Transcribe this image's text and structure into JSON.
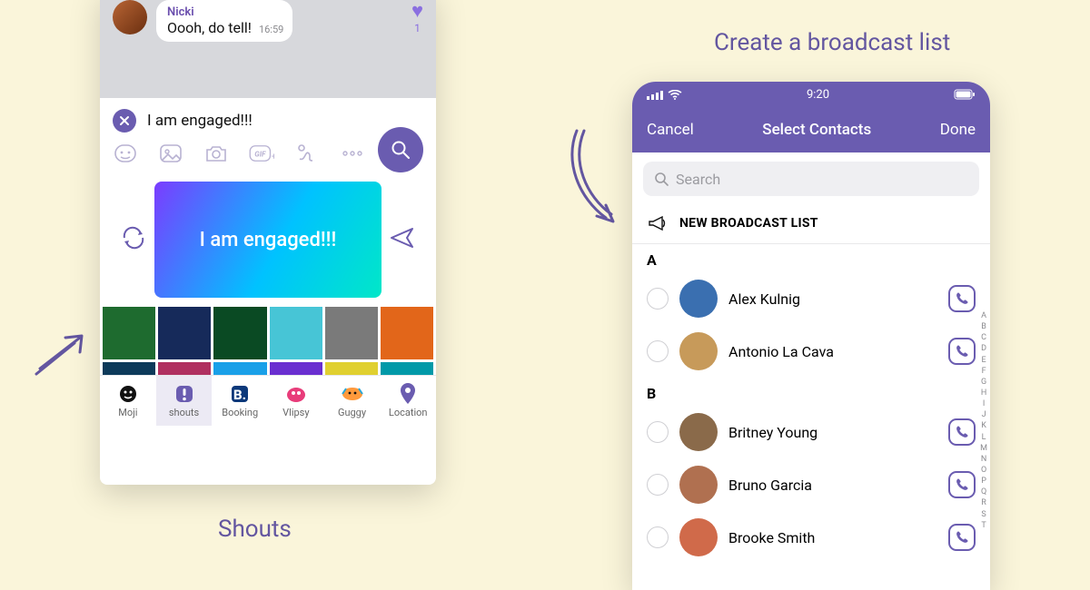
{
  "captions": {
    "left": "Shouts",
    "right": "Create a broadcast list"
  },
  "chat": {
    "sender": "Nicki",
    "message": "Oooh, do tell!",
    "time": "16:59",
    "reaction_count": "1"
  },
  "composer": {
    "text": "I am engaged!!!",
    "card_text": "I am engaged!!!"
  },
  "tool_icons": [
    "sticker-icon",
    "picture-icon",
    "camera-icon",
    "gif-icon",
    "doodle-icon",
    "more-icon"
  ],
  "bg_palettes_row1": [
    "#1e6b2f",
    "#162a5a",
    "#0a4a23",
    "#47c5d6",
    "#7a7a7a",
    "#e2661a"
  ],
  "bg_palettes_row2": [
    "#0d3a5a",
    "#b03060",
    "#1aa0e8",
    "#6a2fd0",
    "#e0d030",
    "#0099a8"
  ],
  "app_tabs": [
    {
      "id": "moji",
      "label": "Moji"
    },
    {
      "id": "shouts",
      "label": "shouts"
    },
    {
      "id": "booking",
      "label": "Booking"
    },
    {
      "id": "vlipsy",
      "label": "Vlipsy"
    },
    {
      "id": "guggy",
      "label": "Guggy"
    },
    {
      "id": "location",
      "label": "Location"
    }
  ],
  "app_tab_active": "shouts",
  "phone2": {
    "status_time": "9:20",
    "nav": {
      "left": "Cancel",
      "title": "Select Contacts",
      "right": "Done"
    },
    "search_placeholder": "Search",
    "new_broadcast": "NEW BROADCAST LIST",
    "sections": [
      {
        "letter": "A",
        "contacts": [
          {
            "name": "Alex Kulnig",
            "avatar_bg": "#3a6fb0"
          },
          {
            "name": "Antonio La Cava",
            "avatar_bg": "#c79a5a"
          }
        ]
      },
      {
        "letter": "B",
        "contacts": [
          {
            "name": "Britney Young",
            "avatar_bg": "#8a6a4a"
          },
          {
            "name": "Bruno Garcia",
            "avatar_bg": "#b07050"
          },
          {
            "name": "Brooke Smith",
            "avatar_bg": "#d06a4a"
          }
        ]
      }
    ],
    "alpha_index": [
      "A",
      "B",
      "C",
      "D",
      "E",
      "F",
      "G",
      "H",
      "I",
      "J",
      "K",
      "L",
      "M",
      "N",
      "O",
      "P",
      "Q",
      "R",
      "S",
      "T"
    ]
  },
  "colors": {
    "accent": "#6a5cb0"
  }
}
